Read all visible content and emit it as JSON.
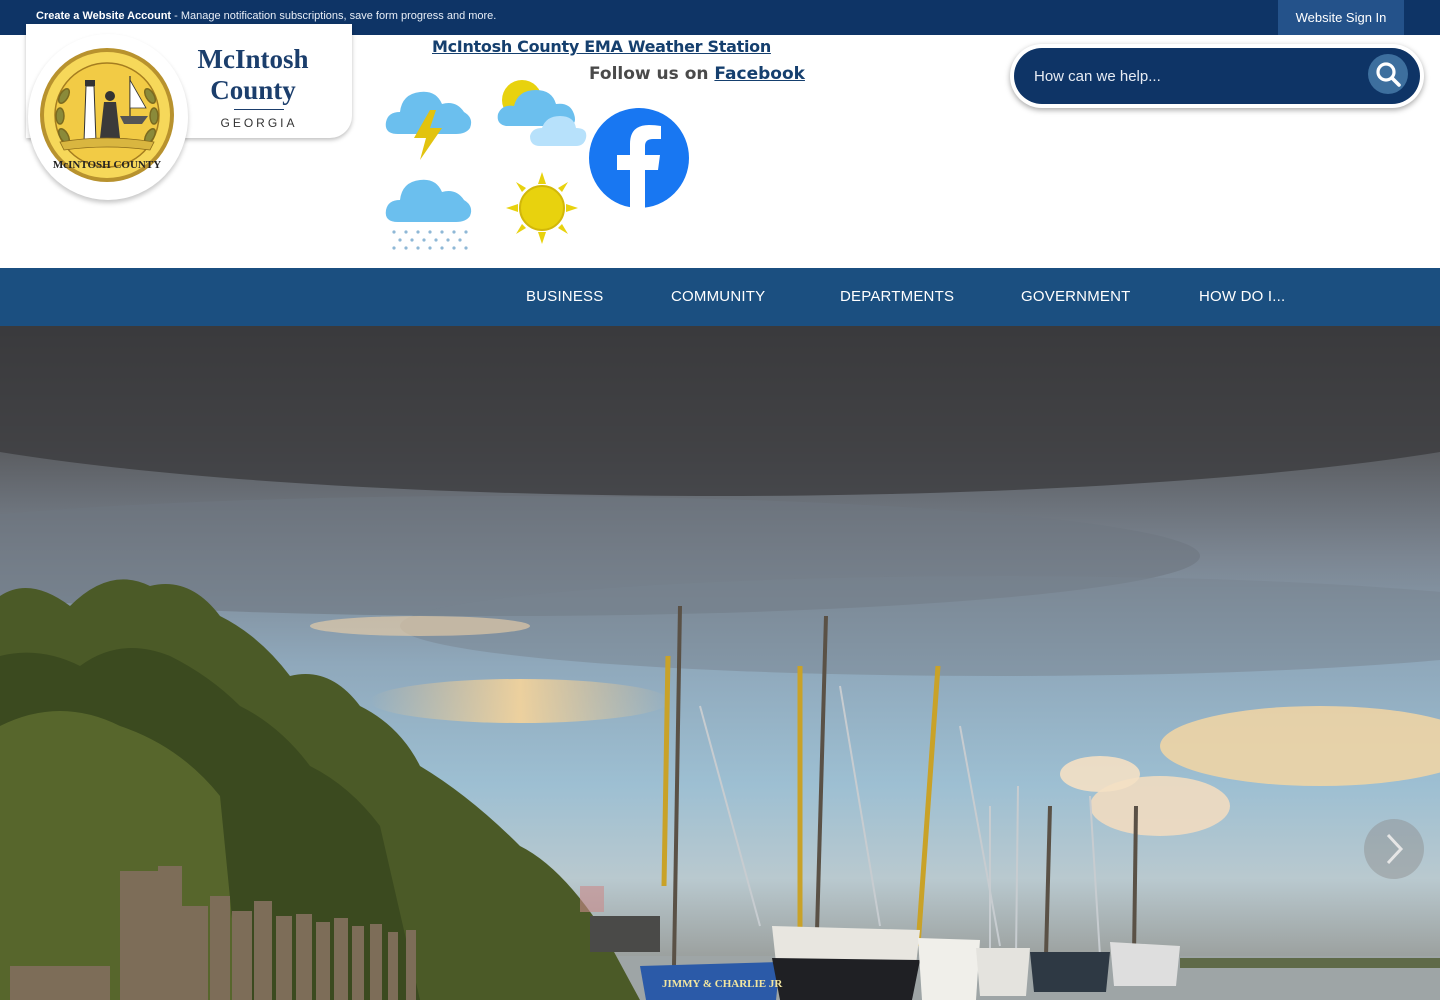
{
  "topbar": {
    "create_account_label": "Create a Website Account",
    "create_account_desc": " - Manage notification subscriptions, save form progress and more.",
    "signin_label": "Website Sign In"
  },
  "logo": {
    "title_line1": "McIntosh",
    "title_line2": "County",
    "state": "GEORGIA",
    "seal_text": "McINTOSH COUNTY"
  },
  "weather": {
    "ema_link": "McIntosh County EMA Weather Station",
    "follow_prefix": "Follow us on ",
    "follow_link": "Facebook",
    "icons": [
      "thunderstorm-icon",
      "partly-cloudy-icon",
      "snow-icon",
      "sun-icon"
    ]
  },
  "search": {
    "placeholder": "How can we help..."
  },
  "nav": {
    "items": [
      "BUSINESS",
      "COMMUNITY",
      "DEPARTMENTS",
      "GOVERNMENT",
      "HOW DO I..."
    ]
  },
  "hero": {
    "boat_name": "JIMMY & CHARLIE JR"
  },
  "colors": {
    "brand_dark": "#0e3466",
    "nav_blue": "#1b4f80",
    "logo_text": "#1b3e6c",
    "facebook_blue": "#1877f2"
  }
}
